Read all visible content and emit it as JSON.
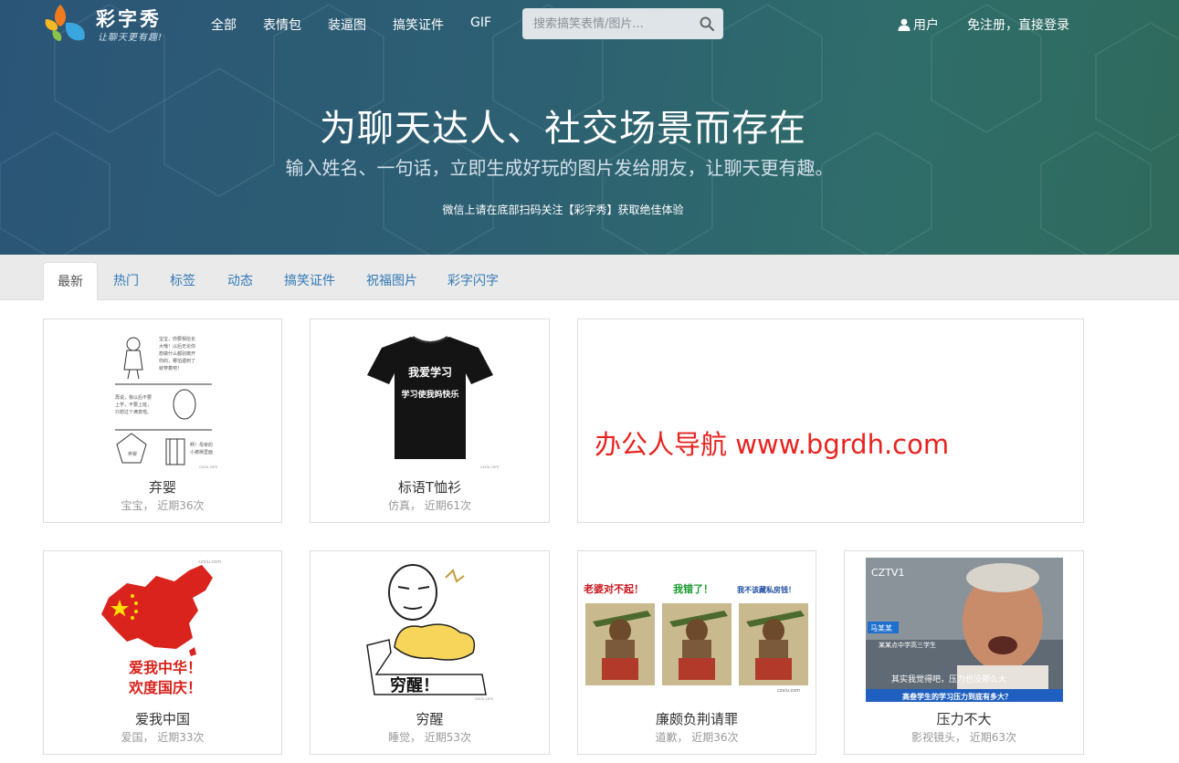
{
  "brand": {
    "name": "彩字秀",
    "slogan": "让聊天更有趣!"
  },
  "nav": {
    "items": [
      "全部",
      "表情包",
      "装逼图",
      "搞笑证件",
      "GIF"
    ]
  },
  "search": {
    "placeholder": "搜索搞笑表情/图片..."
  },
  "user": {
    "label": "用户",
    "login": "免注册，直接登录"
  },
  "hero": {
    "title": "为聊天达人、社交场景而存在",
    "subtitle": "输入姓名、一句话，立即生成好玩的图片发给朋友，让聊天更有趣。",
    "note": "微信上请在底部扫码关注【彩字秀】获取绝佳体验"
  },
  "tabs": [
    "最新",
    "热门",
    "标签",
    "动态",
    "搞笑证件",
    "祝福图片",
    "彩字闪字"
  ],
  "cards": [
    {
      "title": "弃婴",
      "meta": "宝宝， 近期36次"
    },
    {
      "title": "标语T恤衫",
      "meta": "仿真， 近期61次",
      "shirt_line1": "我爱学习",
      "shirt_line2": "学习使我妈快乐"
    },
    {
      "title": "爱我中国",
      "meta": "爱国， 近期33次",
      "line1": "爱我中华！",
      "line2": "欢度国庆！"
    },
    {
      "title": "穷醒",
      "meta": "睡觉， 近期53次",
      "caption": "穷醒！"
    },
    {
      "title": "廉颇负荆请罪",
      "meta": "道歉， 近期36次",
      "panel1": "老婆对不起！",
      "panel2": "我错了！",
      "panel3": "我不该藏私房钱！"
    },
    {
      "title": "压力不大",
      "meta": "影视镜头， 近期63次",
      "channel": "CZTV1",
      "tag": "马某某",
      "line1": "某某点中学高三学生",
      "line2": "其实我觉得吧，压力也没那么大",
      "bottom": "高叁学生的学习压力到底有多大？"
    }
  ],
  "ad": {
    "text": "办公人导航 www.bgrdh.com"
  },
  "watermark": "czxiu.com",
  "colors": {
    "link": "#337ab7",
    "ad": "#e8231f",
    "china_red": "#d9231c"
  }
}
